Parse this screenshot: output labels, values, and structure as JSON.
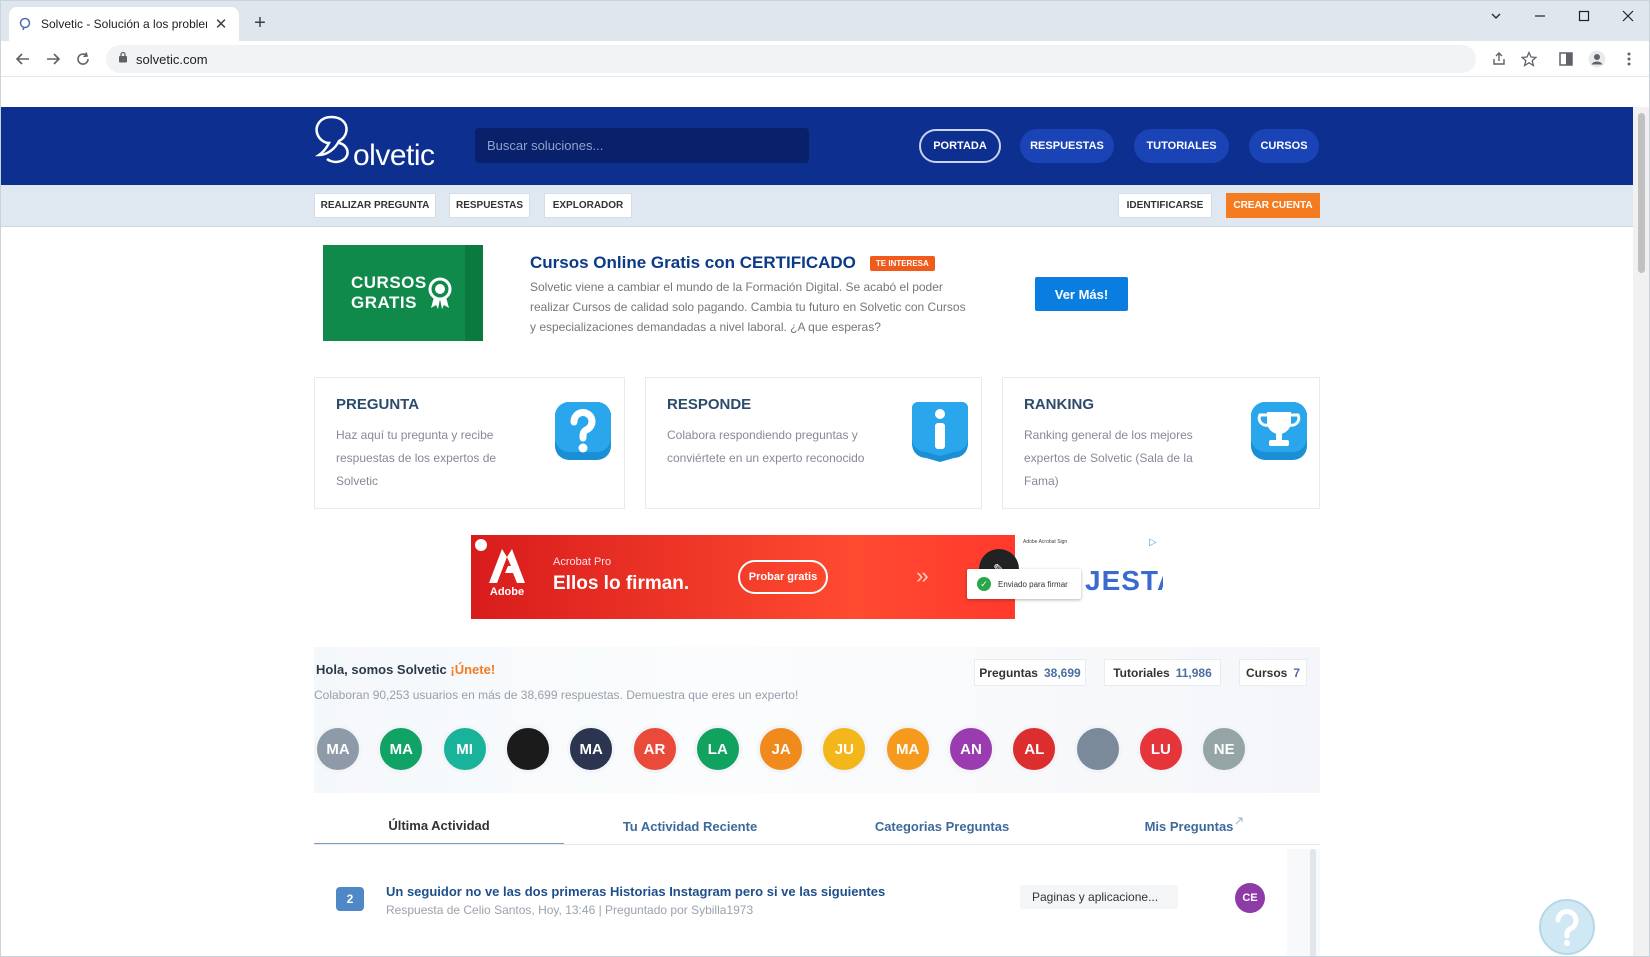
{
  "browser": {
    "tab_title": "Solvetic - Solución a los problem",
    "url": "solvetic.com"
  },
  "header": {
    "logo_text": "olvetic",
    "search_placeholder": "Buscar soluciones...",
    "nav": [
      "PORTADA",
      "RESPUESTAS",
      "TUTORIALES",
      "CURSOS"
    ]
  },
  "subnav": {
    "left": [
      "REALIZAR PREGUNTA",
      "RESPUESTAS",
      "EXPLORADOR"
    ],
    "login": "IDENTIFICARSE",
    "register": "CREAR CUENTA"
  },
  "promo": {
    "image_line1": "CURSOS",
    "image_line2": "GRATIS",
    "title": "Cursos Online Gratis con CERTIFICADO",
    "badge": "TE INTERESA",
    "description": "Solvetic viene a cambiar el mundo de la Formación Digital. Se acabó el poder realizar Cursos de calidad solo pagando. Cambia tu futuro en Solvetic con Cursos y especializaciones demandadas a nivel laboral. ¿A que esperas?",
    "button": "Ver Más!"
  },
  "cards": [
    {
      "title": "PREGUNTA",
      "desc": "Haz aquí tu pregunta y recibe respuestas de los expertos de Solvetic",
      "icon": "question-icon"
    },
    {
      "title": "RESPONDE",
      "desc": "Colabora respondiendo preguntas y conviértete en un experto reconocido",
      "icon": "info-icon"
    },
    {
      "title": "RANKING",
      "desc": "Ranking general de los mejores expertos de Solvetic (Sala de la Fama)",
      "icon": "trophy-icon"
    }
  ],
  "ad": {
    "brand": "Adobe",
    "subtitle": "Acrobat Pro",
    "headline": "Ellos lo firman.",
    "button": "Probar gratis",
    "popup": "Enviado para firmar",
    "right_top": "Adobe Acrobat Sign",
    "big_text": "JESTA"
  },
  "community": {
    "hello": "Hola, somos Solvetic",
    "join": "¡Únete!",
    "sub": "Colaboran 90,253 usuarios en más de 38,699 respuestas. Demuestra que eres un experto!",
    "stats": [
      {
        "label": "Preguntas",
        "value": "38,699"
      },
      {
        "label": "Tutoriales",
        "value": "11,986"
      },
      {
        "label": "Cursos",
        "value": "7"
      }
    ],
    "avatars": [
      {
        "initials": "MA",
        "color": "#8e9aa8"
      },
      {
        "initials": "MA",
        "color": "#11a366"
      },
      {
        "initials": "MI",
        "color": "#18b39a"
      },
      {
        "initials": "",
        "color": "#1b1b1b"
      },
      {
        "initials": "MA",
        "color": "#2c3550"
      },
      {
        "initials": "AR",
        "color": "#e94a3a"
      },
      {
        "initials": "LA",
        "color": "#12a25f"
      },
      {
        "initials": "JA",
        "color": "#f08a1c"
      },
      {
        "initials": "JU",
        "color": "#f3b61b"
      },
      {
        "initials": "MA",
        "color": "#f59a1d"
      },
      {
        "initials": "AN",
        "color": "#9a3bb0"
      },
      {
        "initials": "AL",
        "color": "#dc2e2e"
      },
      {
        "initials": "",
        "color": "#7a8a9a"
      },
      {
        "initials": "LU",
        "color": "#e5353a"
      },
      {
        "initials": "NE",
        "color": "#95a5a6"
      }
    ]
  },
  "tabs": [
    "Última Actividad",
    "Tu Actividad Reciente",
    "Categorias Preguntas",
    "Mis Preguntas"
  ],
  "activity": {
    "count": "2",
    "title": "Un seguidor no ve las dos primeras Historias Instagram pero si ve las siguientes",
    "meta": "Respuesta de Celio Santos, Hoy, 13:46  |  Preguntado por Sybilla1973",
    "category": "Paginas y aplicacione...",
    "avatar": "CE"
  }
}
